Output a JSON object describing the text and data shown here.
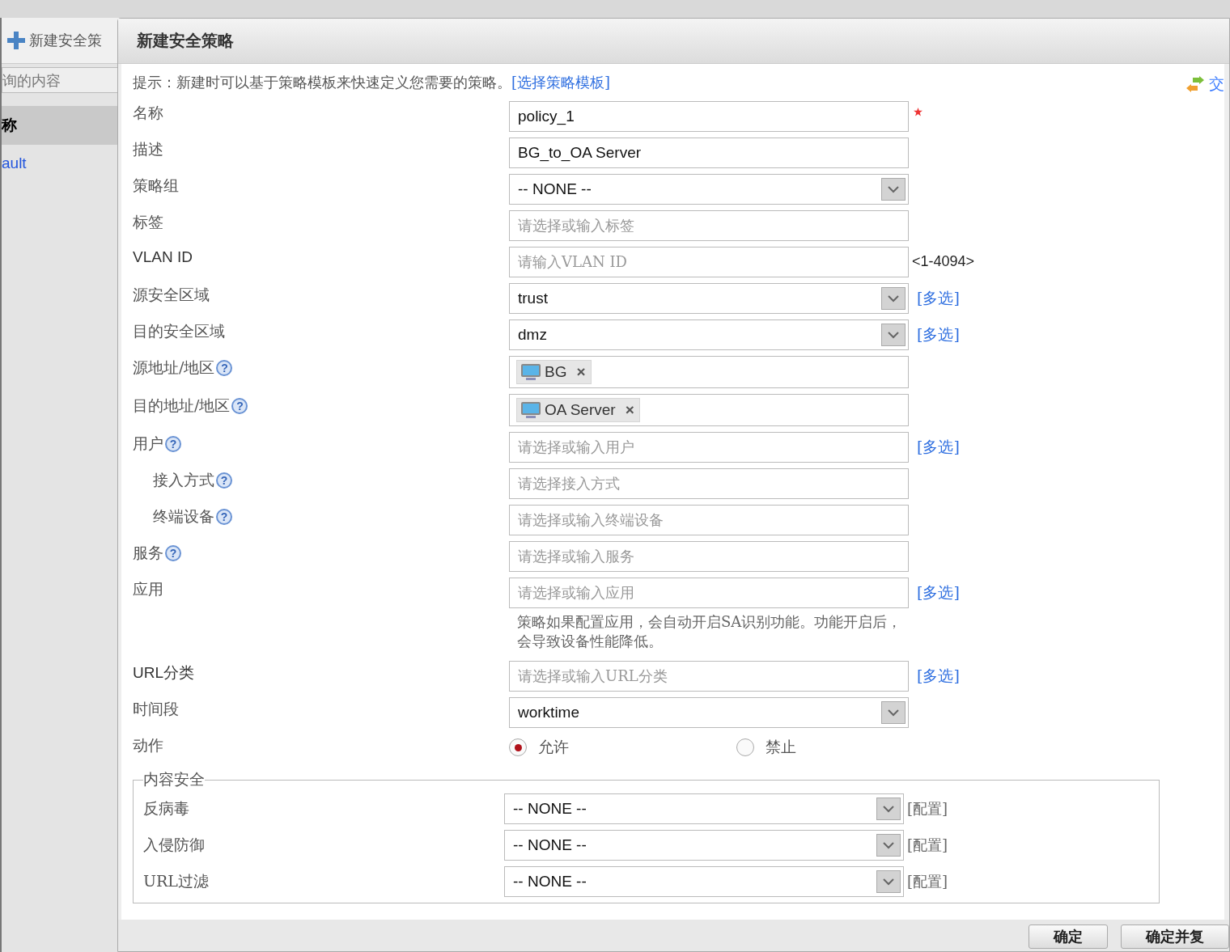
{
  "sidebar": {
    "toolbar_button": "新建安全策",
    "search": {
      "placeholder": "询的内容"
    },
    "rows": [
      {
        "text": "称",
        "kind": "header"
      },
      {
        "text": "ault",
        "kind": "link"
      }
    ]
  },
  "dialog": {
    "title": "新建安全策略",
    "hint": {
      "text": "提示：新建时可以基于策略模板来快速定义您需要的策略。",
      "link": "[选择策略模板]"
    },
    "swap_link": "交",
    "fields": [
      {
        "label": "名称",
        "kind": "text",
        "value": "policy_1",
        "required": true
      },
      {
        "label": "描述",
        "kind": "text",
        "value": "BG_to_OA Server"
      },
      {
        "label": "策略组",
        "kind": "select",
        "value": "-- NONE --"
      },
      {
        "label": "标签",
        "kind": "text",
        "placeholder": "请选择或输入标签"
      },
      {
        "label": "VLAN ID",
        "kind": "text",
        "placeholder": "请输入VLAN ID",
        "suffix": "<1-4094>"
      },
      {
        "label": "源安全区域",
        "kind": "select",
        "value": "trust",
        "link": "[多选]"
      },
      {
        "label": "目的安全区域",
        "kind": "select",
        "value": "dmz",
        "link": "[多选]"
      },
      {
        "label": "源地址/地区",
        "help": "?",
        "kind": "tags",
        "tags": [
          {
            "text": "BG",
            "remove": "×"
          }
        ]
      },
      {
        "label": "目的地址/地区",
        "help": "?",
        "kind": "tags",
        "tags": [
          {
            "text": "OA Server",
            "remove": "×"
          }
        ]
      },
      {
        "label": "用户",
        "help": "?",
        "kind": "text",
        "placeholder": "请选择或输入用户",
        "link": "[多选]",
        "children": [
          {
            "label": "接入方式",
            "help": "?",
            "kind": "text",
            "placeholder": "请选择接入方式"
          },
          {
            "label": "终端设备",
            "help": "?",
            "kind": "text",
            "placeholder": "请选择或输入终端设备"
          }
        ]
      },
      {
        "label": "服务",
        "help": "?",
        "kind": "text",
        "placeholder": "请选择或输入服务"
      },
      {
        "label": "应用",
        "kind": "text",
        "placeholder": "请选择或输入应用",
        "link": "[多选]",
        "note": "策略如果配置应用，会自动开启SA识别功能。功能开启后，会导致设备性能降低。"
      },
      {
        "label": "URL分类",
        "kind": "text",
        "placeholder": "请选择或输入URL分类",
        "link": "[多选]"
      },
      {
        "label": "时间段",
        "kind": "select",
        "value": "worktime"
      },
      {
        "label": "动作",
        "kind": "radio",
        "options": [
          {
            "text": "允许",
            "selected": true
          },
          {
            "text": "禁止",
            "selected": false
          }
        ]
      }
    ],
    "content_security": {
      "legend": "内容安全",
      "rows": [
        {
          "label": "反病毒",
          "value": "-- NONE --",
          "link": "[配置]"
        },
        {
          "label": "入侵防御",
          "value": "-- NONE --",
          "link": "[配置]"
        },
        {
          "label": "URL过滤",
          "value": "-- NONE --",
          "link": "[配置]"
        }
      ]
    },
    "buttons": [
      "确定",
      "确定并复"
    ]
  }
}
